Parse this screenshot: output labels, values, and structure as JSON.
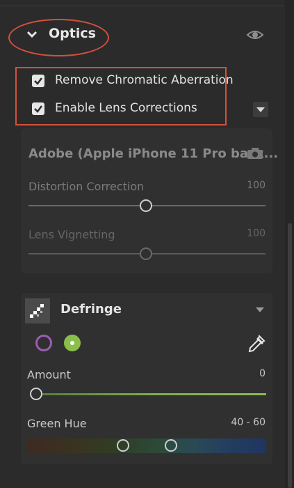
{
  "panel": {
    "section_title": "Optics"
  },
  "options": [
    {
      "label": "Remove Chromatic Aberration",
      "checked": true
    },
    {
      "label": "Enable Lens Corrections",
      "checked": true
    }
  ],
  "lens_profile": {
    "name": "Adobe (Apple iPhone 11 Pro back...",
    "distortion": {
      "label": "Distortion Correction",
      "value": "100",
      "level": 0.5
    },
    "vignetting": {
      "label": "Lens Vignetting",
      "value": "100",
      "level": 0.5
    }
  },
  "defringe": {
    "title": "Defringe",
    "amount": {
      "label": "Amount",
      "value": "0",
      "level": 0.0
    },
    "green_hue": {
      "label": "Green Hue",
      "value": "40 - 60",
      "low": 40,
      "high": 60
    }
  },
  "icons": {
    "chevron": "chevron-down-icon",
    "visibility": "eye-icon",
    "camera": "camera-icon",
    "defringe": "defringe-icon",
    "eyedropper": "eyedropper-icon"
  },
  "colors": {
    "highlight": "#d4503c",
    "purple_fringe": "#9b5db3",
    "green_fringe": "#8bbf4c",
    "background": "#2b2b2b"
  }
}
